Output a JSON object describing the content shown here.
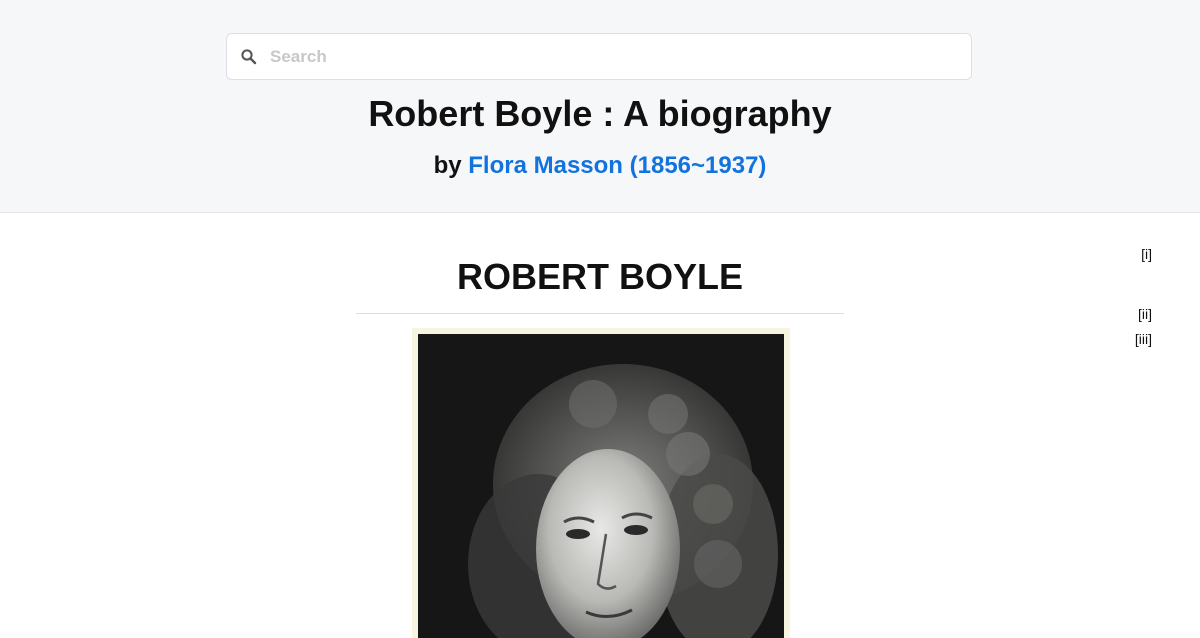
{
  "search": {
    "placeholder": "Search",
    "icon": "search-icon"
  },
  "book": {
    "title": "Robert Boyle : A biography",
    "by_label": "by",
    "author": "Flora Masson (1856~1937)"
  },
  "content": {
    "heading": "ROBERT BOYLE",
    "portrait_icon": "portrait-image"
  },
  "page_markers": [
    "[i]",
    "[ii]",
    "[iii]"
  ]
}
